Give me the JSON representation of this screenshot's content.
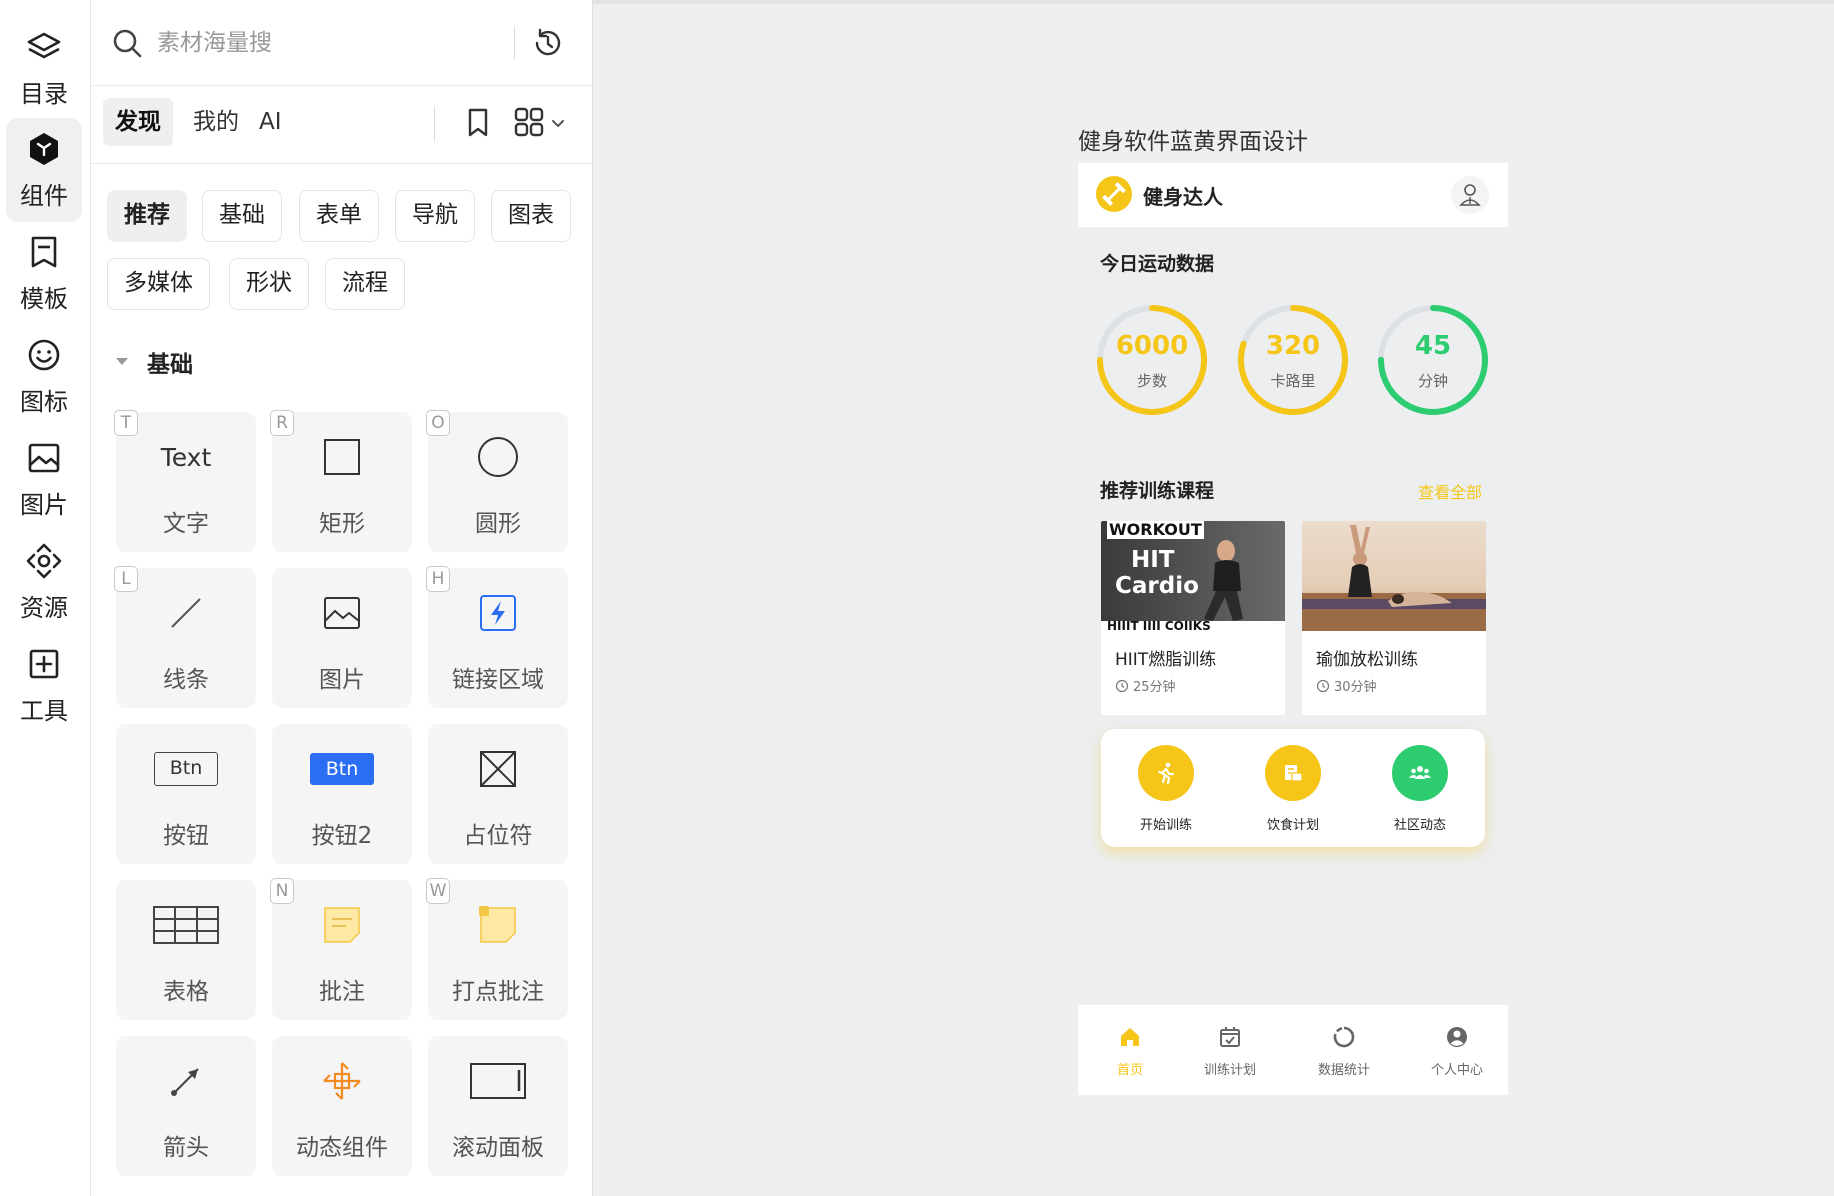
{
  "rail": {
    "items": [
      {
        "label": "目录",
        "icon": "layers-icon"
      },
      {
        "label": "组件",
        "icon": "component-cube-icon",
        "active": true
      },
      {
        "label": "模板",
        "icon": "bookmark-template-icon"
      },
      {
        "label": "图标",
        "icon": "smiley-icon"
      },
      {
        "label": "图片",
        "icon": "image-icon"
      },
      {
        "label": "资源",
        "icon": "resource-icon"
      },
      {
        "label": "工具",
        "icon": "plus-box-icon"
      }
    ]
  },
  "panel": {
    "search_placeholder": "素材海量搜",
    "tabs": [
      {
        "label": "发现",
        "active": true
      },
      {
        "label": "我的"
      },
      {
        "label": "AI"
      }
    ],
    "chips": [
      "推荐",
      "基础",
      "表单",
      "导航",
      "图表",
      "多媒体",
      "形状",
      "流程"
    ],
    "section_title": "基础",
    "components": [
      {
        "name": "文字",
        "shortcut": "T",
        "glyph_text": "Text"
      },
      {
        "name": "矩形",
        "shortcut": "R"
      },
      {
        "name": "圆形",
        "shortcut": "O"
      },
      {
        "name": "线条",
        "shortcut": "L"
      },
      {
        "name": "图片",
        "shortcut": ""
      },
      {
        "name": "链接区域",
        "shortcut": "H"
      },
      {
        "name": "按钮",
        "shortcut": "",
        "glyph_text": "Btn"
      },
      {
        "name": "按钮2",
        "shortcut": "",
        "glyph_text": "Btn"
      },
      {
        "name": "占位符",
        "shortcut": ""
      },
      {
        "name": "表格",
        "shortcut": ""
      },
      {
        "name": "批注",
        "shortcut": "N"
      },
      {
        "name": "打点批注",
        "shortcut": "W"
      },
      {
        "name": "箭头",
        "shortcut": ""
      },
      {
        "name": "动态组件",
        "shortcut": ""
      },
      {
        "name": "滚动面板",
        "shortcut": ""
      }
    ]
  },
  "canvas": {
    "frame_title": "健身软件蓝黄界面设计",
    "app": {
      "name": "健身达人",
      "today_title": "今日运动数据",
      "stats": [
        {
          "value": "6000",
          "label": "步数",
          "progress": 0.75,
          "color": "#f5c518"
        },
        {
          "value": "320",
          "label": "卡路里",
          "progress": 0.8,
          "color": "#f5c518"
        },
        {
          "value": "45",
          "label": "分钟",
          "progress": 0.75,
          "color": "#2ecc71"
        }
      ],
      "recommend_title": "推荐训练课程",
      "see_all": "查看全部",
      "courses": [
        {
          "name": "HIIT燃脂训练",
          "duration": "25分钟",
          "thumb_lines": [
            "WORKOUT",
            "HIT",
            "Cardio",
            "HIIIT IIII COIIKS"
          ]
        },
        {
          "name": "瑜伽放松训练",
          "duration": "30分钟"
        }
      ],
      "quick_actions": [
        {
          "label": "开始训练",
          "icon": "running-icon",
          "color": "#f5c518"
        },
        {
          "label": "饮食计划",
          "icon": "diet-plan-icon",
          "color": "#f5c518"
        },
        {
          "label": "社区动态",
          "icon": "community-icon",
          "color": "#2ecc71"
        }
      ],
      "nav": [
        {
          "label": "首页",
          "icon": "home-icon",
          "active": true
        },
        {
          "label": "训练计划",
          "icon": "calendar-check-icon"
        },
        {
          "label": "数据统计",
          "icon": "stats-ring-icon"
        },
        {
          "label": "个人中心",
          "icon": "user-circle-icon"
        }
      ]
    }
  },
  "colors": {
    "accent_yellow": "#f5c518",
    "accent_green": "#2ecc71",
    "link_blue": "#2b6ef3",
    "note_yellow": "#fde9a3"
  }
}
